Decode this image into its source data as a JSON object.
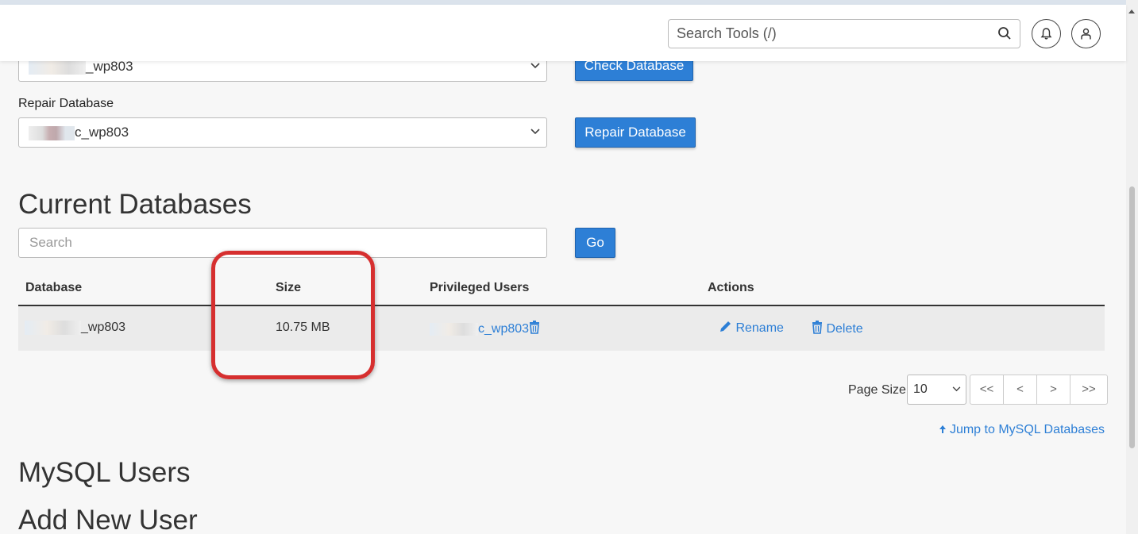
{
  "header": {
    "search_placeholder": "Search Tools (/)"
  },
  "check": {
    "selected": "_wp803",
    "button": "Check Database"
  },
  "repair": {
    "label": "Repair Database",
    "selected": "c_wp803",
    "button": "Repair Database"
  },
  "current": {
    "title": "Current Databases",
    "search_placeholder": "Search",
    "go": "Go",
    "columns": [
      "Database",
      "Size",
      "Privileged Users",
      "Actions"
    ],
    "rows": [
      {
        "database": "_wp803",
        "size": "10.75 MB",
        "user": "c_wp803",
        "rename": "Rename",
        "delete": "Delete"
      }
    ]
  },
  "pagination": {
    "page_size_label": "Page Size",
    "page_size": "10",
    "buttons": [
      "<<",
      "<",
      ">",
      ">>"
    ]
  },
  "jump": "Jump to MySQL Databases",
  "mysql_users_title": "MySQL Users",
  "add_user_title": "Add New User",
  "colors": {
    "primary": "#2d7fd6",
    "highlight": "#d62f2f"
  }
}
